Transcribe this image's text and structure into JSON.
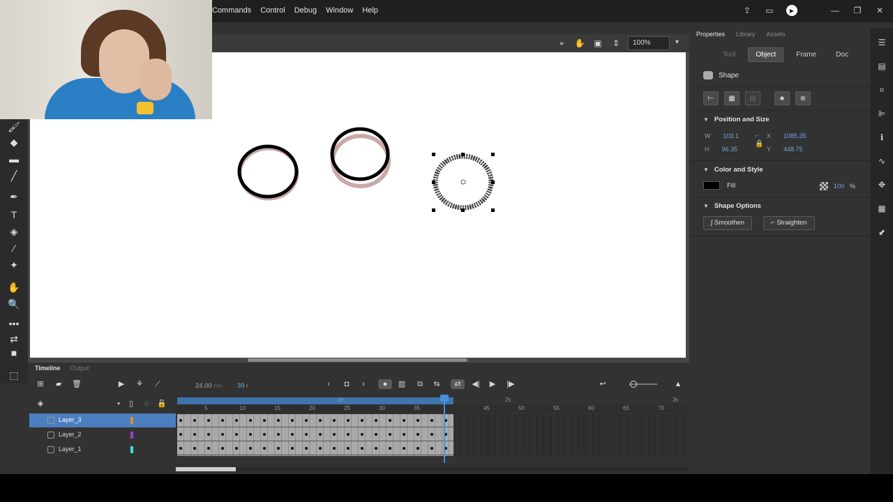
{
  "menu": {
    "items": [
      "Commands",
      "Control",
      "Debug",
      "Window",
      "Help"
    ]
  },
  "stage": {
    "zoom": "100%"
  },
  "properties": {
    "panel_tabs": [
      "Properties",
      "Library",
      "Assets"
    ],
    "sub_tabs": [
      "Tool",
      "Object",
      "Frame",
      "Doc"
    ],
    "active_sub_tab": "Object",
    "object_type": "Shape",
    "position_size": {
      "title": "Position and Size",
      "w_label": "W",
      "w_value": "103.1",
      "h_label": "H",
      "h_value": "96.35",
      "x_label": "X",
      "x_value": "1085.35",
      "y_label": "Y",
      "y_value": "448.75"
    },
    "color_style": {
      "title": "Color and Style",
      "fill_label": "Fill",
      "fill_color": "#000000",
      "alpha_value": "100",
      "alpha_unit": "%"
    },
    "shape_options": {
      "title": "Shape Options",
      "smoothen": "Smoothen",
      "straighten": "Straighten"
    }
  },
  "timeline": {
    "tabs": [
      "Timeline",
      "Output"
    ],
    "fps": "24.00",
    "fps_unit": "FPS",
    "current_frame": "39",
    "frame_unit": "F",
    "ruler_labels": [
      "5",
      "10",
      "15",
      "20",
      "25",
      "30",
      "35",
      "45",
      "50",
      "55",
      "60",
      "65",
      "70"
    ],
    "time_labels": [
      "1s",
      "2s",
      "3s"
    ],
    "layers": [
      {
        "name": "Layer_3",
        "color": "#e08a2c",
        "selected": true
      },
      {
        "name": "Layer_2",
        "color": "#9b3fc9",
        "selected": false
      },
      {
        "name": "Layer_1",
        "color": "#38e0e0",
        "selected": false
      }
    ]
  }
}
